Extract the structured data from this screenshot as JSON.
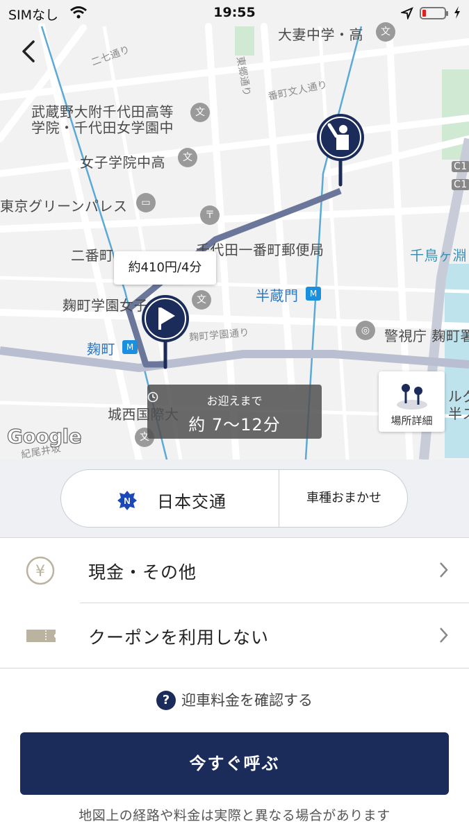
{
  "status_bar": {
    "carrier": "SIMなし",
    "time": "19:55"
  },
  "map": {
    "labels": {
      "otsuma": "大妻中学・高",
      "nichome": "二七通り",
      "tohdo": "東郷通り",
      "bancho": "番町文人通り",
      "musashino": "武蔵野大附千代田高等",
      "musashino2": "学院・千代田女学園中",
      "joshi": "女子学院中高",
      "green": "東京グリーンパレス",
      "nibancho": "二番町",
      "post": "千代田一番町郵便局",
      "chidori": "千鳥ヶ淵",
      "hanzomon": "半蔵門",
      "kojimachi_school": "麹町学園女子",
      "kojimachi_dori": "麹町学園通り",
      "keishicho": "警視庁 麹町署",
      "kojimachi": "麹町",
      "josai": "城西国際大",
      "kioi": "紀尾井坂",
      "c1a": "C1",
      "c1b": "C1",
      "right_frag1": "ルグ",
      "right_frag2": "半ス"
    },
    "fare_bubble": "約410円/4分",
    "pickup_eta": {
      "caption": "お迎えまで",
      "value": "約 7〜12分"
    },
    "place_detail": "場所詳細",
    "google": "Google"
  },
  "provider": {
    "name": "日本交通",
    "car_type": "車種おまかせ"
  },
  "payment": {
    "label": "現金・その他"
  },
  "coupon": {
    "label": "クーポンを利用しない"
  },
  "fee_link": "迎車料金を確認する",
  "call_button": "今すぐ呼ぶ",
  "disclaimer": "地図上の経路や料金は実際と異なる場合があります",
  "colors": {
    "navy": "#1b2b5a",
    "route": "#6b779a",
    "metro": "#1a8fe0"
  }
}
